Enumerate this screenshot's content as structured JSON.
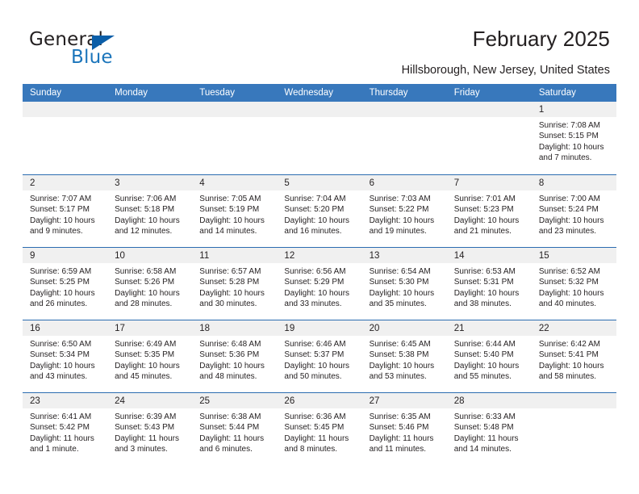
{
  "brand": {
    "word_one": "General",
    "word_two": "Blue",
    "triangle_color": "#0b5ea8",
    "blue_color": "#1b75bb"
  },
  "header": {
    "title": "February 2025",
    "subtitle": "Hillsborough, New Jersey, United States"
  },
  "theme": {
    "header_row_bg": "#3878bc",
    "row_divider": "#2c6cb0",
    "day_band_bg": "#f0f0f0",
    "text": "#231f20"
  },
  "calendar": {
    "weekday_headers": [
      "Sunday",
      "Monday",
      "Tuesday",
      "Wednesday",
      "Thursday",
      "Friday",
      "Saturday"
    ],
    "weeks": [
      [
        {
          "day": "",
          "lines": []
        },
        {
          "day": "",
          "lines": []
        },
        {
          "day": "",
          "lines": []
        },
        {
          "day": "",
          "lines": []
        },
        {
          "day": "",
          "lines": []
        },
        {
          "day": "",
          "lines": []
        },
        {
          "day": "1",
          "lines": [
            "Sunrise: 7:08 AM",
            "Sunset: 5:15 PM",
            "Daylight: 10 hours",
            "and 7 minutes."
          ]
        }
      ],
      [
        {
          "day": "2",
          "lines": [
            "Sunrise: 7:07 AM",
            "Sunset: 5:17 PM",
            "Daylight: 10 hours",
            "and 9 minutes."
          ]
        },
        {
          "day": "3",
          "lines": [
            "Sunrise: 7:06 AM",
            "Sunset: 5:18 PM",
            "Daylight: 10 hours",
            "and 12 minutes."
          ]
        },
        {
          "day": "4",
          "lines": [
            "Sunrise: 7:05 AM",
            "Sunset: 5:19 PM",
            "Daylight: 10 hours",
            "and 14 minutes."
          ]
        },
        {
          "day": "5",
          "lines": [
            "Sunrise: 7:04 AM",
            "Sunset: 5:20 PM",
            "Daylight: 10 hours",
            "and 16 minutes."
          ]
        },
        {
          "day": "6",
          "lines": [
            "Sunrise: 7:03 AM",
            "Sunset: 5:22 PM",
            "Daylight: 10 hours",
            "and 19 minutes."
          ]
        },
        {
          "day": "7",
          "lines": [
            "Sunrise: 7:01 AM",
            "Sunset: 5:23 PM",
            "Daylight: 10 hours",
            "and 21 minutes."
          ]
        },
        {
          "day": "8",
          "lines": [
            "Sunrise: 7:00 AM",
            "Sunset: 5:24 PM",
            "Daylight: 10 hours",
            "and 23 minutes."
          ]
        }
      ],
      [
        {
          "day": "9",
          "lines": [
            "Sunrise: 6:59 AM",
            "Sunset: 5:25 PM",
            "Daylight: 10 hours",
            "and 26 minutes."
          ]
        },
        {
          "day": "10",
          "lines": [
            "Sunrise: 6:58 AM",
            "Sunset: 5:26 PM",
            "Daylight: 10 hours",
            "and 28 minutes."
          ]
        },
        {
          "day": "11",
          "lines": [
            "Sunrise: 6:57 AM",
            "Sunset: 5:28 PM",
            "Daylight: 10 hours",
            "and 30 minutes."
          ]
        },
        {
          "day": "12",
          "lines": [
            "Sunrise: 6:56 AM",
            "Sunset: 5:29 PM",
            "Daylight: 10 hours",
            "and 33 minutes."
          ]
        },
        {
          "day": "13",
          "lines": [
            "Sunrise: 6:54 AM",
            "Sunset: 5:30 PM",
            "Daylight: 10 hours",
            "and 35 minutes."
          ]
        },
        {
          "day": "14",
          "lines": [
            "Sunrise: 6:53 AM",
            "Sunset: 5:31 PM",
            "Daylight: 10 hours",
            "and 38 minutes."
          ]
        },
        {
          "day": "15",
          "lines": [
            "Sunrise: 6:52 AM",
            "Sunset: 5:32 PM",
            "Daylight: 10 hours",
            "and 40 minutes."
          ]
        }
      ],
      [
        {
          "day": "16",
          "lines": [
            "Sunrise: 6:50 AM",
            "Sunset: 5:34 PM",
            "Daylight: 10 hours",
            "and 43 minutes."
          ]
        },
        {
          "day": "17",
          "lines": [
            "Sunrise: 6:49 AM",
            "Sunset: 5:35 PM",
            "Daylight: 10 hours",
            "and 45 minutes."
          ]
        },
        {
          "day": "18",
          "lines": [
            "Sunrise: 6:48 AM",
            "Sunset: 5:36 PM",
            "Daylight: 10 hours",
            "and 48 minutes."
          ]
        },
        {
          "day": "19",
          "lines": [
            "Sunrise: 6:46 AM",
            "Sunset: 5:37 PM",
            "Daylight: 10 hours",
            "and 50 minutes."
          ]
        },
        {
          "day": "20",
          "lines": [
            "Sunrise: 6:45 AM",
            "Sunset: 5:38 PM",
            "Daylight: 10 hours",
            "and 53 minutes."
          ]
        },
        {
          "day": "21",
          "lines": [
            "Sunrise: 6:44 AM",
            "Sunset: 5:40 PM",
            "Daylight: 10 hours",
            "and 55 minutes."
          ]
        },
        {
          "day": "22",
          "lines": [
            "Sunrise: 6:42 AM",
            "Sunset: 5:41 PM",
            "Daylight: 10 hours",
            "and 58 minutes."
          ]
        }
      ],
      [
        {
          "day": "23",
          "lines": [
            "Sunrise: 6:41 AM",
            "Sunset: 5:42 PM",
            "Daylight: 11 hours",
            "and 1 minute."
          ]
        },
        {
          "day": "24",
          "lines": [
            "Sunrise: 6:39 AM",
            "Sunset: 5:43 PM",
            "Daylight: 11 hours",
            "and 3 minutes."
          ]
        },
        {
          "day": "25",
          "lines": [
            "Sunrise: 6:38 AM",
            "Sunset: 5:44 PM",
            "Daylight: 11 hours",
            "and 6 minutes."
          ]
        },
        {
          "day": "26",
          "lines": [
            "Sunrise: 6:36 AM",
            "Sunset: 5:45 PM",
            "Daylight: 11 hours",
            "and 8 minutes."
          ]
        },
        {
          "day": "27",
          "lines": [
            "Sunrise: 6:35 AM",
            "Sunset: 5:46 PM",
            "Daylight: 11 hours",
            "and 11 minutes."
          ]
        },
        {
          "day": "28",
          "lines": [
            "Sunrise: 6:33 AM",
            "Sunset: 5:48 PM",
            "Daylight: 11 hours",
            "and 14 minutes."
          ]
        },
        {
          "day": "",
          "lines": []
        }
      ]
    ]
  }
}
